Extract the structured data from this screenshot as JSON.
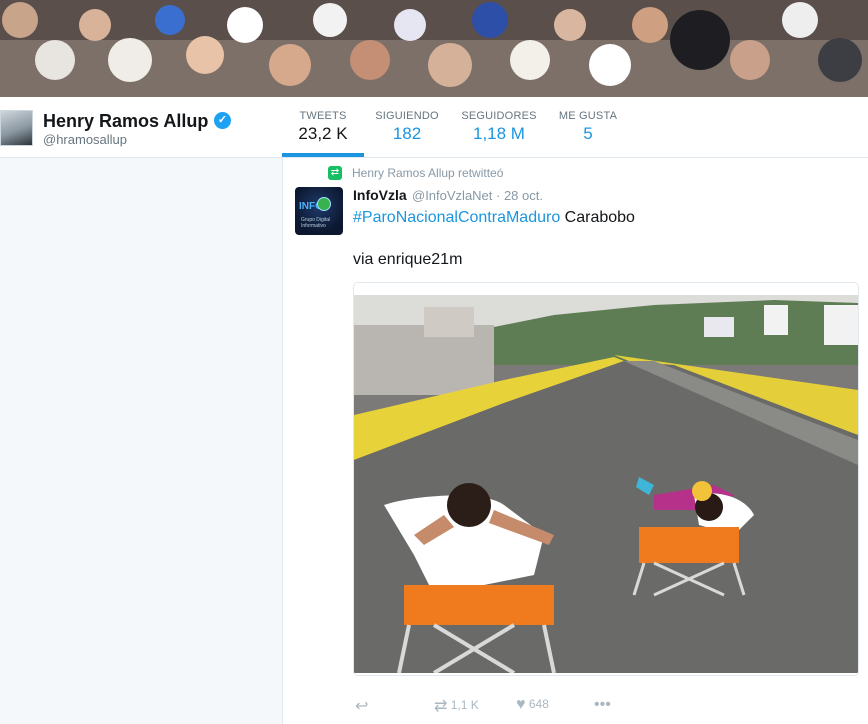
{
  "profile": {
    "name": "Henry Ramos Allup",
    "handle": "@hramosallup"
  },
  "stats": [
    {
      "label": "TWEETS",
      "value": "23,2 K"
    },
    {
      "label": "SIGUIENDO",
      "value": "182"
    },
    {
      "label": "SEGUIDORES",
      "value": "1,18 M"
    },
    {
      "label": "ME GUSTA",
      "value": "5"
    }
  ],
  "tweet": {
    "retweet_context": "Henry Ramos Allup retwitteó",
    "author_name": "InfoVzla",
    "author_handle": "@InfoVzlaNet · 28 oct.",
    "avatar_logo": "INFO",
    "avatar_sub": "Grupo Digital Informativo",
    "hashtag": "#ParoNacionalContraMaduro",
    "text_rest": " Carabobo",
    "via": "via enrique21m",
    "retweets": "1,1 K",
    "likes": "648"
  },
  "icons": {
    "verified": "verified-badge-icon",
    "retweet_small": "retweet-icon",
    "reply": "reply-icon",
    "retweet": "retweet-icon",
    "like": "heart-icon",
    "more": "more-icon"
  },
  "colors": {
    "accent": "#1b95e0",
    "retweet_green": "#17bf63"
  }
}
